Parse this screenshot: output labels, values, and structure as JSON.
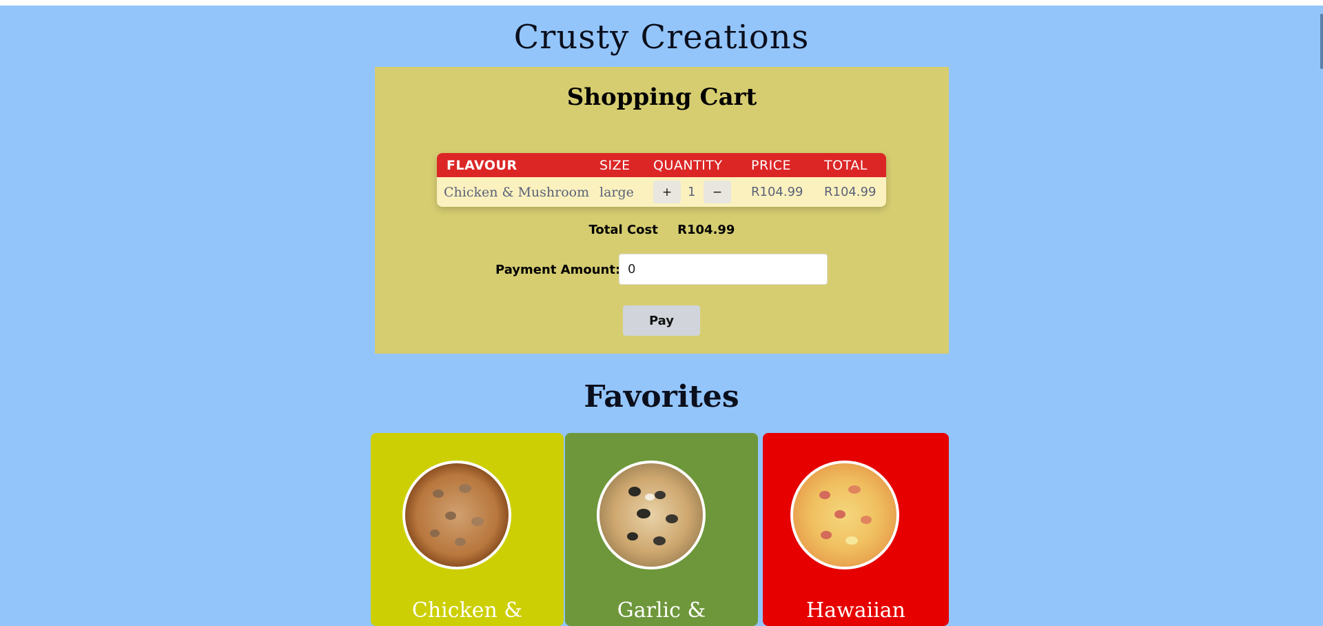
{
  "site": {
    "title": "Crusty Creations"
  },
  "cart": {
    "title": "Shopping Cart",
    "columns": [
      "FLAVOUR",
      "SIZE",
      "QUANTITY",
      "PRICE",
      "TOTAL"
    ],
    "rows": [
      {
        "flavour": "Chicken & Mushroom",
        "size": "large",
        "quantity": "1",
        "price": "R104.99",
        "total": "R104.99",
        "plus_label": "+",
        "minus_label": "−"
      }
    ],
    "total_label": "Total Cost",
    "total_value": "R104.99",
    "payment_label": "Payment Amount:",
    "payment_value": "0",
    "pay_button": "Pay"
  },
  "favorites": {
    "title": "Favorites",
    "items": [
      {
        "name": "Chicken &",
        "color": "#cccf03"
      },
      {
        "name": "Garlic &",
        "color": "#6e973b"
      },
      {
        "name": "Hawaiian",
        "color": "#e60000"
      }
    ]
  },
  "colors": {
    "background": "#93c5fb",
    "cart_panel": "#d6cd71",
    "table_header": "#dc2626"
  }
}
